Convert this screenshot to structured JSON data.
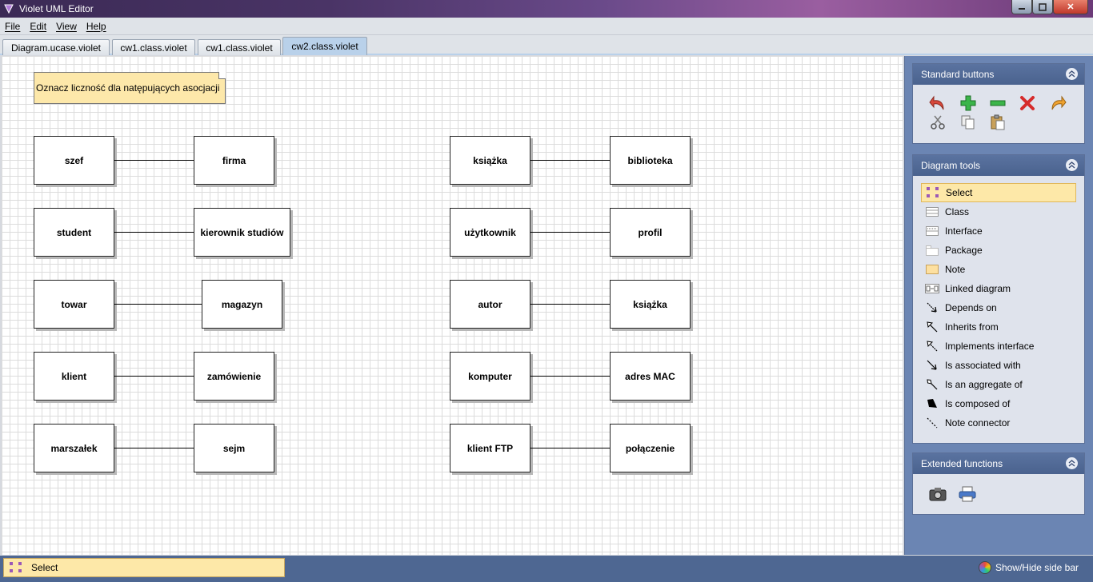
{
  "window": {
    "title": "Violet UML Editor"
  },
  "menu": [
    "File",
    "Edit",
    "View",
    "Help"
  ],
  "tabs": [
    {
      "label": "Diagram.ucase.violet",
      "active": false
    },
    {
      "label": "cw1.class.violet",
      "active": false
    },
    {
      "label": "cw1.class.violet",
      "active": false
    },
    {
      "label": "cw2.class.violet",
      "active": true
    }
  ],
  "diagram": {
    "note": "Oznacz liczność dla natępujących asocjacji",
    "classes": [
      "szef",
      "firma",
      "student",
      "kierownik studiów",
      "towar",
      "magazyn",
      "klient",
      "zamówienie",
      "marszałek",
      "sejm",
      "książka",
      "biblioteka",
      "użytkownik",
      "profil",
      "autor",
      "książka",
      "komputer",
      "adres MAC",
      "klient FTP",
      "połączenie"
    ]
  },
  "sidebar": {
    "standard_buttons": {
      "title": "Standard buttons",
      "icons": [
        "undo-icon",
        "add-icon",
        "remove-icon",
        "delete-icon",
        "redo-icon",
        "cut-icon",
        "copy-icon",
        "paste-icon"
      ]
    },
    "diagram_tools": {
      "title": "Diagram tools",
      "items": [
        {
          "label": "Select",
          "icon": "select-icon",
          "selected": true
        },
        {
          "label": "Class",
          "icon": "class-icon"
        },
        {
          "label": "Interface",
          "icon": "interface-icon"
        },
        {
          "label": "Package",
          "icon": "package-icon"
        },
        {
          "label": "Note",
          "icon": "note-icon"
        },
        {
          "label": "Linked diagram",
          "icon": "linked-diagram-icon"
        },
        {
          "label": "Depends on",
          "icon": "depends-icon"
        },
        {
          "label": "Inherits from",
          "icon": "inherits-icon"
        },
        {
          "label": "Implements interface",
          "icon": "implements-icon"
        },
        {
          "label": "Is associated with",
          "icon": "association-icon"
        },
        {
          "label": "Is an aggregate of",
          "icon": "aggregation-icon"
        },
        {
          "label": "Is composed of",
          "icon": "composition-icon"
        },
        {
          "label": "Note connector",
          "icon": "note-connector-icon"
        }
      ]
    },
    "extended_functions": {
      "title": "Extended functions",
      "icons": [
        "camera-icon",
        "print-icon"
      ]
    }
  },
  "statusbar": {
    "current_tool": "Select",
    "toggle_label": "Show/Hide side bar"
  },
  "colors": {
    "accent": "#fde8a8",
    "sidebar": "#6b85b3",
    "header": "#4e6792"
  }
}
